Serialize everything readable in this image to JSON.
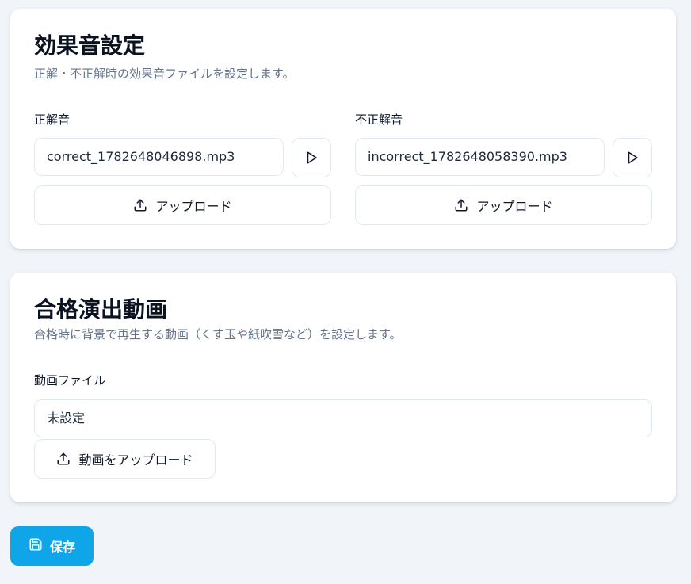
{
  "sound_settings": {
    "title": "効果音設定",
    "description": "正解・不正解時の効果音ファイルを設定します。",
    "correct": {
      "label": "正解音",
      "file_name": "correct_1782648046898.mp3",
      "upload_label": "アップロード"
    },
    "incorrect": {
      "label": "不正解音",
      "file_name": "incorrect_1782648058390.mp3",
      "upload_label": "アップロード"
    }
  },
  "video_settings": {
    "title": "合格演出動画",
    "description": "合格時に背景で再生する動画（くす玉や紙吹雪など）を設定します。",
    "field_label": "動画ファイル",
    "file_value": "未設定",
    "upload_label": "動画をアップロード"
  },
  "actions": {
    "save_label": "保存"
  },
  "icons": {
    "play": "play-icon",
    "upload": "upload-icon",
    "save": "save-icon"
  },
  "colors": {
    "accent": "#0ea5e9",
    "background": "#f1f4f9",
    "card": "#ffffff",
    "muted_text": "#64748b"
  }
}
